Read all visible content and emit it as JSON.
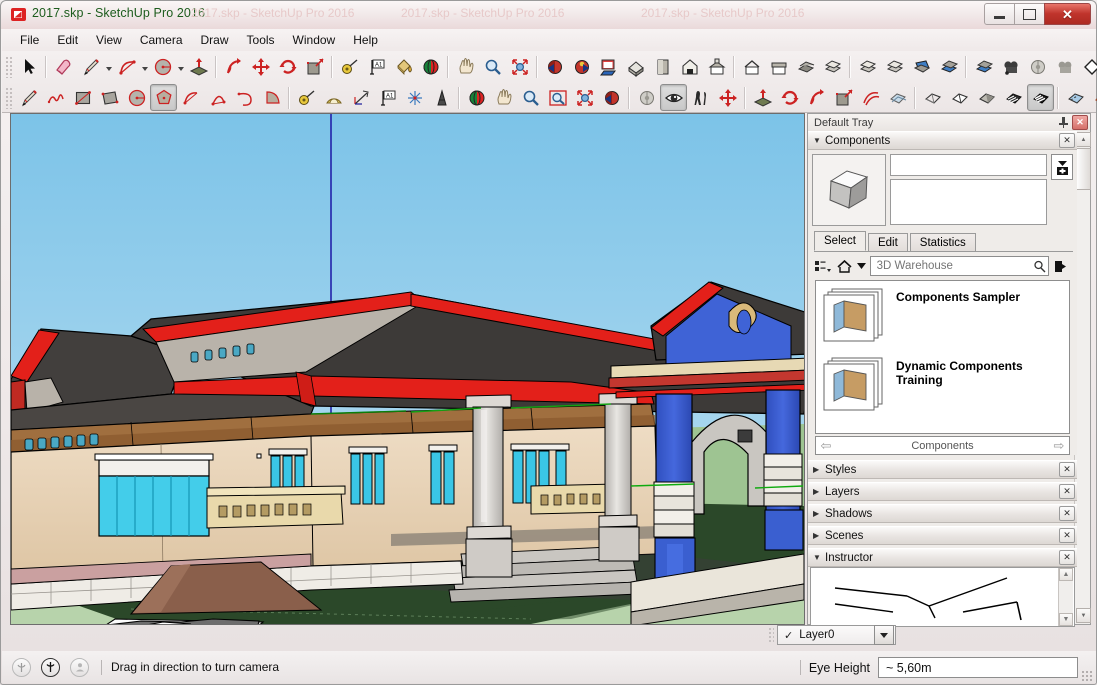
{
  "window": {
    "title": "2017.skp - SketchUp Pro 2016",
    "ghost_title": "2017.skp - SketchUp Pro 2016",
    "app_icon": "sketchup-logo-icon",
    "minimize_label": "–",
    "maximize_label": "□",
    "close_label": "✕"
  },
  "menubar": {
    "items": [
      {
        "label": "File"
      },
      {
        "label": "Edit"
      },
      {
        "label": "View"
      },
      {
        "label": "Camera"
      },
      {
        "label": "Draw"
      },
      {
        "label": "Tools"
      },
      {
        "label": "Window"
      },
      {
        "label": "Help"
      }
    ]
  },
  "toolbars": {
    "row1": [
      {
        "name": "select-tool",
        "icon": "arrow-cursor-icon"
      },
      {
        "name": "eraser-tool",
        "icon": "eraser-icon"
      },
      {
        "name": "line-tool",
        "icon": "pencil-icon",
        "caret": true
      },
      {
        "name": "arc-tool",
        "icon": "arc-icon",
        "caret": true
      },
      {
        "name": "circle-tool",
        "icon": "circle-icon",
        "caret": true
      },
      {
        "name": "pushpull-tool",
        "icon": "pushpull-icon"
      },
      {
        "name": "followme-tool",
        "icon": "followme-icon"
      },
      {
        "name": "move-tool",
        "icon": "move-arrows-icon"
      },
      {
        "name": "rotate-tool",
        "icon": "rotate-icon"
      },
      {
        "name": "scale-tool",
        "icon": "scale-icon"
      },
      {
        "name": "tape-measure-tool",
        "icon": "tape-measure-icon"
      },
      {
        "name": "dimension-tool",
        "icon": "dimension-icon"
      },
      {
        "name": "paint-bucket-tool",
        "icon": "paint-bucket-icon"
      },
      {
        "name": "orbit-tool",
        "icon": "orbit-icon"
      },
      {
        "name": "pan-tool",
        "icon": "hand-icon"
      },
      {
        "name": "zoom-tool",
        "icon": "magnifier-icon"
      },
      {
        "name": "zoom-extents-tool",
        "icon": "zoom-extents-icon"
      },
      {
        "name": "previous-view",
        "icon": "previous-view-icon"
      },
      {
        "name": "next-view",
        "icon": "next-view-icon"
      },
      {
        "name": "print-button",
        "icon": "print-icon"
      },
      {
        "name": "view-iso",
        "icon": "iso-house-icon"
      },
      {
        "name": "view-top",
        "icon": "top-view-icon"
      },
      {
        "name": "view-front",
        "icon": "front-house-icon"
      },
      {
        "name": "view-right",
        "icon": "right-house-icon"
      },
      {
        "name": "view-back",
        "icon": "back-house-icon"
      },
      {
        "name": "view-left",
        "icon": "left-house-icon"
      },
      {
        "name": "scene-manager",
        "icon": "scenes-icon"
      },
      {
        "name": "layer-add",
        "icon": "layers-add-icon"
      },
      {
        "name": "layer-manager",
        "icon": "layers-icon"
      },
      {
        "name": "layer-delete",
        "icon": "layers-del-icon"
      },
      {
        "name": "section-plane",
        "icon": "section-plane-icon"
      },
      {
        "name": "section-display",
        "icon": "section-display-icon"
      },
      {
        "name": "section-cuts",
        "icon": "section-cuts-icon"
      },
      {
        "name": "walkthrough-tool",
        "icon": "camera-walk-icon"
      },
      {
        "name": "position-camera",
        "icon": "camera-position-icon"
      },
      {
        "name": "look-around",
        "icon": "camera-look-icon"
      },
      {
        "name": "sandbox-tool",
        "icon": "diamond-icon"
      }
    ],
    "row2": [
      {
        "name": "line-tool-2",
        "icon": "pencil-icon"
      },
      {
        "name": "freehand-tool",
        "icon": "freehand-icon"
      },
      {
        "name": "rectangle-tool",
        "icon": "rectangle-icon"
      },
      {
        "name": "rotated-rectangle-tool",
        "icon": "rotated-rectangle-icon"
      },
      {
        "name": "circle-tool-2",
        "icon": "circle-icon"
      },
      {
        "name": "polygon-tool",
        "icon": "polygon-icon",
        "selected": true
      },
      {
        "name": "arc-tool-2",
        "icon": "arc2-icon"
      },
      {
        "name": "two-point-arc-tool",
        "icon": "two-point-arc-icon"
      },
      {
        "name": "three-point-arc-tool",
        "icon": "three-point-arc-icon"
      },
      {
        "name": "pie-tool",
        "icon": "pie-icon"
      },
      {
        "name": "tape-measure-tool-2",
        "icon": "tape-measure-icon"
      },
      {
        "name": "protractor-tool",
        "icon": "protractor-icon"
      },
      {
        "name": "axes-tool",
        "icon": "axes-tool-icon"
      },
      {
        "name": "text-tool",
        "icon": "text-icon"
      },
      {
        "name": "axes-tool-2",
        "icon": "axes-icon"
      },
      {
        "name": "three-d-text-tool",
        "icon": "3dtext-icon"
      },
      {
        "name": "orbit-tool-2",
        "icon": "orbit-icon"
      },
      {
        "name": "pan-tool-2",
        "icon": "hand-icon"
      },
      {
        "name": "zoom-tool-2",
        "icon": "magnifier-icon"
      },
      {
        "name": "zoom-window-tool",
        "icon": "zoom-window-icon"
      },
      {
        "name": "zoom-extents-tool-2",
        "icon": "zoom-extents-icon"
      },
      {
        "name": "previous-view-2",
        "icon": "previous-view-icon"
      },
      {
        "name": "position-camera-2",
        "icon": "camera-position-icon"
      },
      {
        "name": "look-around-2",
        "icon": "eye-icon",
        "selected": true
      },
      {
        "name": "walk-tool",
        "icon": "walk-icon"
      },
      {
        "name": "move-tool-2",
        "icon": "move-arrows-icon"
      },
      {
        "name": "pushpull-tool-2",
        "icon": "pushpull-icon"
      },
      {
        "name": "rotate-tool-2",
        "icon": "rotate-icon"
      },
      {
        "name": "followme-tool-2",
        "icon": "followme-icon"
      },
      {
        "name": "scale-tool-2",
        "icon": "scale-icon"
      },
      {
        "name": "offset-tool",
        "icon": "offset-icon"
      },
      {
        "name": "style-xray",
        "icon": "xray-style-icon"
      },
      {
        "name": "style-wireframe",
        "icon": "wireframe-style-icon"
      },
      {
        "name": "style-hidden-line",
        "icon": "hiddenline-style-icon"
      },
      {
        "name": "style-shaded",
        "icon": "shaded-style-icon"
      },
      {
        "name": "style-shaded-texture",
        "icon": "texture-style-icon"
      },
      {
        "name": "style-monochrome",
        "icon": "monochrome-style-icon",
        "selected": true
      },
      {
        "name": "style-back-edges",
        "icon": "backedges-style-icon"
      },
      {
        "name": "style-sketchy",
        "icon": "sketchy-style-icon"
      }
    ]
  },
  "tray": {
    "title": "Default Tray",
    "pin_icon": "pin-icon",
    "close_label": "✕",
    "panels": {
      "components": {
        "title": "Components",
        "expanded": true,
        "triangle": "▼",
        "close_label": "✕",
        "thumbnail_icon": "component-cube-icon",
        "name_value": "",
        "description_value": "",
        "expand_button_icon": "expand-collapse-icon",
        "tabs": [
          {
            "label": "Select",
            "active": true
          },
          {
            "label": "Edit",
            "active": false
          },
          {
            "label": "Statistics",
            "active": false
          }
        ],
        "nav": {
          "view_options_icon": "view-options-icon",
          "home_icon": "home-icon",
          "dropdown_icon": "chevron-down-icon",
          "search_placeholder": "3D Warehouse",
          "search_value": "",
          "search_icon": "magnifier-icon",
          "details_icon": "details-arrow-icon"
        },
        "items": [
          {
            "label": "Components Sampler",
            "icon": "folder-stack-icon"
          },
          {
            "label": "Dynamic Components Training",
            "icon": "folder-stack-icon"
          }
        ],
        "footer": {
          "back_icon": "arrow-left-icon",
          "label": "Components",
          "forward_icon": "arrow-right-icon"
        }
      },
      "collapsed": [
        {
          "label": "Styles",
          "triangle": "▶",
          "close_label": "✕"
        },
        {
          "label": "Layers",
          "triangle": "▶",
          "close_label": "✕"
        },
        {
          "label": "Shadows",
          "triangle": "▶",
          "close_label": "✕"
        },
        {
          "label": "Scenes",
          "triangle": "▶",
          "close_label": "✕"
        }
      ],
      "instructor": {
        "label": "Instructor",
        "triangle": "▼",
        "close_label": "✕",
        "scroll_up_icon": "scroll-up-icon",
        "scroll_down_icon": "scroll-down-icon"
      }
    }
  },
  "statusbar": {
    "icons": [
      {
        "name": "geo-location-icon",
        "glyph": "●"
      },
      {
        "name": "credits-info-icon",
        "glyph": "ⓘ"
      },
      {
        "name": "user-account-icon",
        "glyph": "●"
      }
    ],
    "message": "Drag in direction to turn camera"
  },
  "layer_control": {
    "check_glyph": "✓",
    "current_layer": "Layer0",
    "dropdown_icon": "chevron-down-icon"
  },
  "value_control": {
    "label": "Eye Height",
    "value": "~ 5,60m"
  },
  "viewport": {
    "name": "3d-model-viewport",
    "model_description": "Single-storey house model with red fascia trim, dark grey hip roof, tan stucco walls, cyan glazed windows, grey classical columns, blue arched entrance porch and a white pavilion on a green lawn",
    "colors": {
      "sky": "#8ecae9",
      "sky_light": "#b8dcf0",
      "grass_far": "#a9cb9a",
      "grass_near": "#2e4a2c",
      "roof": "#3d3a38",
      "fascia_red": "#e3201a",
      "wall_tan": "#e3c8a6",
      "wall_light": "#efdcc2",
      "window_cyan": "#36c4e8",
      "column_grey": "#c8c6c3",
      "arch_blue": "#3a5fd0",
      "wood_brown": "#9b6637",
      "axis_blue": "#2222aa"
    }
  }
}
